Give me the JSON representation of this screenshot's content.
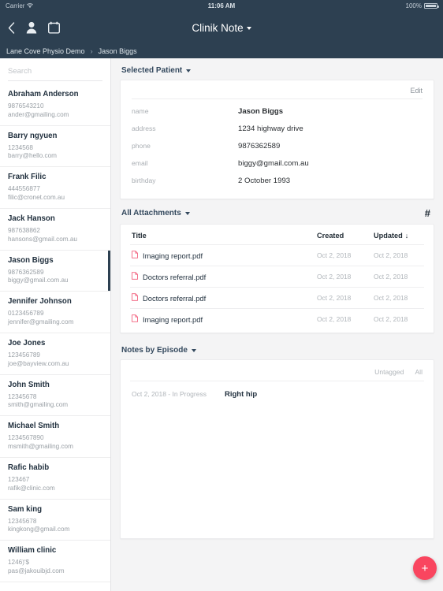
{
  "status_bar": {
    "carrier": "Carrier",
    "wifi_icon": "wifi-icon",
    "time": "11:06 AM",
    "battery": "100%"
  },
  "nav": {
    "back_icon": "back-chevron-icon",
    "person_icon": "person-icon",
    "calendar_icon": "calendar-icon",
    "title": "Clinik Note"
  },
  "breadcrumb": {
    "root": "Lane Cove Physio Demo",
    "separator": "›",
    "current": "Jason Biggs"
  },
  "sidebar": {
    "search_placeholder": "Search",
    "search_value": "",
    "patients": [
      {
        "name": "Abraham Anderson",
        "phone": "9876543210",
        "email": "ander@gmailing.com",
        "selected": false
      },
      {
        "name": "Barry ngyuen",
        "phone": "1234568",
        "email": "barry@hello.com",
        "selected": false
      },
      {
        "name": "Frank Filic",
        "phone": "444556877",
        "email": "filic@cronet.com.au",
        "selected": false
      },
      {
        "name": "Jack Hanson",
        "phone": "987638862",
        "email": "hansons@gmail.com.au",
        "selected": false
      },
      {
        "name": "Jason Biggs",
        "phone": "9876362589",
        "email": "biggy@gmail.com.au",
        "selected": true
      },
      {
        "name": "Jennifer Johnson",
        "phone": "0123456789",
        "email": "jennifer@gmailing.com",
        "selected": false
      },
      {
        "name": "Joe Jones",
        "phone": "123456789",
        "email": "joe@bayview.com.au",
        "selected": false
      },
      {
        "name": "John Smith",
        "phone": "12345678",
        "email": "smith@gmailing.com",
        "selected": false
      },
      {
        "name": "Michael Smith",
        "phone": "1234567890",
        "email": "msmith@gmailing.com",
        "selected": false
      },
      {
        "name": "Rafic habib",
        "phone": "123467",
        "email": "rafik@clinic.com",
        "selected": false
      },
      {
        "name": "Sam king",
        "phone": "12345678",
        "email": "kingkong@gmail.com",
        "selected": false
      },
      {
        "name": "William  clinic",
        "phone": "1246)'$",
        "email": "pas@jakouibjd.com",
        "selected": false
      }
    ]
  },
  "selected_patient": {
    "section_label": "Selected Patient",
    "edit_label": "Edit",
    "fields": [
      {
        "label": "name",
        "value": "Jason Biggs",
        "strong": true
      },
      {
        "label": "address",
        "value": "1234 highway drive",
        "strong": false
      },
      {
        "label": "phone",
        "value": "9876362589",
        "strong": false
      },
      {
        "label": "email",
        "value": "biggy@gmail.com.au",
        "strong": false
      },
      {
        "label": "birthday",
        "value": "2 October 1993",
        "strong": false
      }
    ]
  },
  "attachments": {
    "section_label": "All Attachments",
    "hash_icon": "hashtag-icon",
    "columns": {
      "title": "Title",
      "created": "Created",
      "updated": "Updated",
      "sort_arrow": "↓"
    },
    "rows": [
      {
        "icon": "pdf-file-icon",
        "title": "Imaging report.pdf",
        "created": "Oct 2, 2018",
        "updated": "Oct 2, 2018"
      },
      {
        "icon": "pdf-file-icon",
        "title": "Doctors referral.pdf",
        "created": "Oct 2, 2018",
        "updated": "Oct 2, 2018"
      },
      {
        "icon": "pdf-file-icon",
        "title": "Doctors referral.pdf",
        "created": "Oct 2, 2018",
        "updated": "Oct 2, 2018"
      },
      {
        "icon": "pdf-file-icon",
        "title": "Imaging report.pdf",
        "created": "Oct 2, 2018",
        "updated": "Oct 2, 2018"
      }
    ]
  },
  "notes": {
    "section_label": "Notes by Episode",
    "filters": {
      "untagged": "Untagged",
      "all": "All"
    },
    "rows": [
      {
        "date": "Oct 2, 2018 - In Progress",
        "title": "Right hip"
      }
    ]
  },
  "fab": {
    "icon": "plus-icon",
    "label": "+",
    "color": "#f9455f"
  }
}
